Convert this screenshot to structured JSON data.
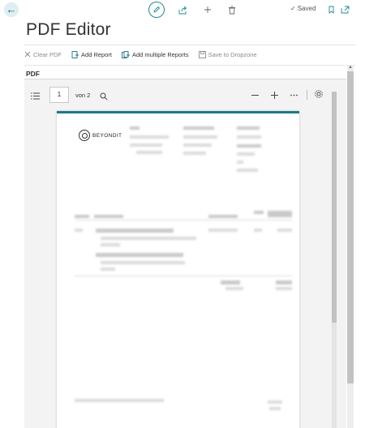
{
  "topbar": {
    "back_icon": "arrow-left-icon",
    "edit_icon": "pencil-icon",
    "share_icon": "share-icon",
    "new_icon": "plus-icon",
    "delete_icon": "trash-icon",
    "saved_label": "Saved",
    "bookmark_icon": "bookmark-icon",
    "popout_icon": "open-in-new-window-icon"
  },
  "title": "PDF Editor",
  "actions": [
    {
      "label": "Clear PDF",
      "icon": "clear-icon",
      "enabled": false
    },
    {
      "label": "Add Report",
      "icon": "report-icon",
      "enabled": true
    },
    {
      "label": "Add multiple Reports",
      "icon": "multiple-reports-icon",
      "enabled": true
    },
    {
      "label": "Save to Dropzone",
      "icon": "save-icon",
      "enabled": false
    }
  ],
  "section_title": "PDF",
  "viewer": {
    "page_number": "1",
    "page_total": "von 2",
    "logo_text": "BEYONDIT"
  },
  "colors": {
    "accent": "#00707a",
    "page_top_border": "#1d7a87"
  }
}
